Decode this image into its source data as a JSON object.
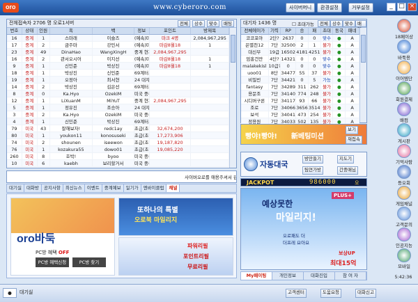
{
  "titlebar": {
    "logo": "oro",
    "url": "www.cyberoro.com",
    "btn1": "사이버머니",
    "btn2": "환경설정",
    "btn3": "거부설정"
  },
  "left_panel": {
    "header": "전체접속자 2706 명  오로1서버",
    "btns": [
      "전체",
      "상수",
      "맞수",
      "배팅"
    ],
    "columns": [
      "번호",
      "상태",
      "인원",
      "흑",
      "",
      "백",
      "",
      "정보",
      "포인트",
      "방제목"
    ],
    "rows": [
      [
        "16",
        "중계",
        "1",
        "스마래",
        "3단",
        "이슬즈",
        "2단",
        "(예속)마자리그",
        "마크 4명",
        "2,084,967,295"
      ],
      [
        "17",
        "중계",
        "2",
        "금주마",
        "3단",
        "강민서",
        "2단",
        "(예속)마자리그",
        "마감8월18",
        "1"
      ],
      [
        "23",
        "중계",
        "49",
        "DinaHao",
        "9단",
        "WangXingH",
        "9단",
        "중계 현재",
        "2,084,967,295",
        ""
      ],
      [
        "16",
        "중계",
        "2",
        "관서오시어",
        "3단",
        "이지선",
        "1단",
        "(예속)마자리그",
        "마감8월18",
        "1"
      ],
      [
        "9",
        "중계",
        "1",
        "신민준",
        "3단",
        "박상진",
        "2단",
        "(예속)마자리그",
        "마감8월18",
        "1"
      ],
      [
        "18",
        "중계",
        "1",
        "박상진",
        "5단",
        "신민준",
        "8단",
        "69계터스배 결승 2국",
        ""
      ],
      [
        "19",
        "중계",
        "1",
        "오정아",
        "3단",
        "최서현",
        "4단",
        "24 대자리그 3R36-3",
        ""
      ],
      [
        "14",
        "중계",
        "2",
        "박상진",
        "5단",
        "김은선",
        "6단",
        "69계터스배 결승 1국",
        ""
      ],
      [
        "8",
        "중계",
        "0",
        "Ka.Hyo",
        "5단",
        "OzekiM",
        "9단",
        "미국 중류",
        ""
      ],
      [
        "12",
        "중계",
        "1",
        "LiXuanM",
        "9단",
        "MiYuT",
        "5단",
        "중계 현재",
        "2,084,967,295",
        ""
      ],
      [
        "5",
        "중계",
        "1",
        "정유진",
        "4단",
        "조승아",
        "4단",
        "24 대자리그 3R36-1",
        ""
      ],
      [
        "3",
        "중계",
        "2",
        "Ka.Hyo",
        "7단",
        "OzekiM",
        "7단",
        "미국 중류",
        ""
      ],
      [
        "4",
        "중계",
        "1",
        "신민준",
        "9단",
        "박상진",
        "9단",
        "69계터스배 결승 1국",
        ""
      ],
      [
        "79",
        "미국",
        "43",
        "잘해보자!",
        "7단",
        "redc1ay",
        "7단",
        "초급(초당)",
        "32,674,200",
        ""
      ],
      [
        "80",
        "미국",
        "1",
        "youkon11",
        "7단",
        "konosuseki",
        "7단",
        "초급(초당)",
        "17,273,906",
        ""
      ],
      [
        "74",
        "미국",
        "2",
        "shounen",
        "7단",
        "iseewon",
        "7단",
        "초급(초당)",
        "19,187,820",
        ""
      ],
      [
        "76",
        "미국",
        "1",
        "kozakura55",
        "7단",
        "dowo01",
        "7단",
        "초급(초당)",
        "19,085,220",
        ""
      ],
      [
        "260",
        "미국",
        "8",
        "호박!",
        "4단",
        "byoo",
        "3단",
        "미국 중류",
        ""
      ],
      [
        "10",
        "미국",
        "6",
        "kaebh",
        "7단",
        "보리할거서",
        "7단",
        "미국 중류",
        ""
      ]
    ]
  },
  "chat": {
    "marquee": "사이버오로를 애용주셔서 감사",
    "placeholder": ""
  },
  "left_tabs": [
    "대기실",
    "대화방",
    "공지사항",
    "최신뉴스",
    "이벤트",
    "중계예보",
    "일기가",
    "엔바이클럽",
    "채널"
  ],
  "ads_left": {
    "oro": "oro바둑",
    "pc_hint": "PC방 혜택",
    "pc_off": "OFF",
    "pc_btn1": "PC방 혜택신청",
    "pc_btn2": "PC방 찾기",
    "event_title": "또하나의 특별",
    "event_sub": "오로북 마일리지",
    "power": "파워리필",
    "point": "포인트리필",
    "free": "무료리필"
  },
  "right_panel": {
    "header": "대기자 1436 명",
    "btns": [
      "전체",
      "상수",
      "맞수",
      "배팅"
    ],
    "check": "초대가능",
    "columns": [
      "전체에이가",
      "기력",
      "RP",
      "승",
      "패",
      "초대",
      "동국",
      "패네"
    ],
    "rows": [
      [
        "코코포아",
        "2단?",
        "2637",
        "0",
        "0",
        "맞수",
        "●",
        "A"
      ],
      [
        "은별천12",
        "7단",
        "32500",
        "2",
        "1",
        "불가",
        "●",
        "A"
      ],
      [
        "대신부",
        "19급",
        "16502",
        "4181",
        "4251",
        "불가",
        "●",
        "A"
      ],
      [
        "엄홍건만",
        "4단?",
        "14321",
        "0",
        "0",
        "맞수",
        "●",
        "A"
      ],
      [
        "malakekisl",
        "10급?",
        "0",
        "0",
        "0",
        "맞수",
        "●",
        "A"
      ],
      [
        "uoo01",
        "8단",
        "34477",
        "55",
        "37",
        "불가",
        "●",
        "A"
      ],
      [
        "비밀빈",
        "7단",
        "34421",
        "0",
        "5",
        "가능",
        "●",
        "A"
      ],
      [
        "fantasy",
        "7단",
        "34289",
        "311",
        "262",
        "불가",
        "●",
        "A"
      ],
      [
        "용문조",
        "7단",
        "34140",
        "774",
        "248",
        "불가",
        "●",
        "A"
      ],
      [
        "시디버구론",
        "7단",
        "34117",
        "93",
        "66",
        "불가",
        "●",
        "A"
      ],
      [
        "조로",
        "7단",
        "34066",
        "3656",
        "3514",
        "불가",
        "●",
        "A"
      ],
      [
        "보석",
        "7단",
        "34041",
        "473",
        "254",
        "불가",
        "●",
        "A"
      ],
      [
        "정용원",
        "7단",
        "34033",
        "502",
        "135",
        "불가",
        "●",
        "A"
      ]
    ]
  },
  "banner_right": {
    "text1": "빵야!빵야!",
    "text2": "新베팅미션",
    "btn1": "보기",
    "btn2": "재접속"
  },
  "daeguk": {
    "title": "자동대국",
    "btn_join": "방만들기",
    "btn_guide": "지도기",
    "btn_chat": "팀연가방",
    "btn_manage": "간중매님"
  },
  "jackpot": {
    "label": "JACKPOT",
    "value": "986000",
    "unit": "오"
  },
  "ads_right": {
    "line1": "예상못한",
    "line2": "마일리지!",
    "sub1": "오로패도 더",
    "sub2": "더프레 요아요",
    "plus": "PLUS+",
    "reward": "보상UP",
    "max": "최대15억"
  },
  "right_tabs": [
    "My패이팅",
    "개인정보",
    "대화진입",
    "참 여 자"
  ],
  "sidebar": [
    "18페이상",
    "바둑용",
    "이어템단",
    "회원결제",
    "배컴",
    "게시판",
    "기억사람",
    "등오회",
    "게임채널",
    "고객문의",
    "인공지능",
    "모바일"
  ],
  "clock": "5:42:36",
  "bottombar": {
    "user": "대기실",
    "b1": "고객센터",
    "b2": "도움요청",
    "b3": "대화신고"
  }
}
